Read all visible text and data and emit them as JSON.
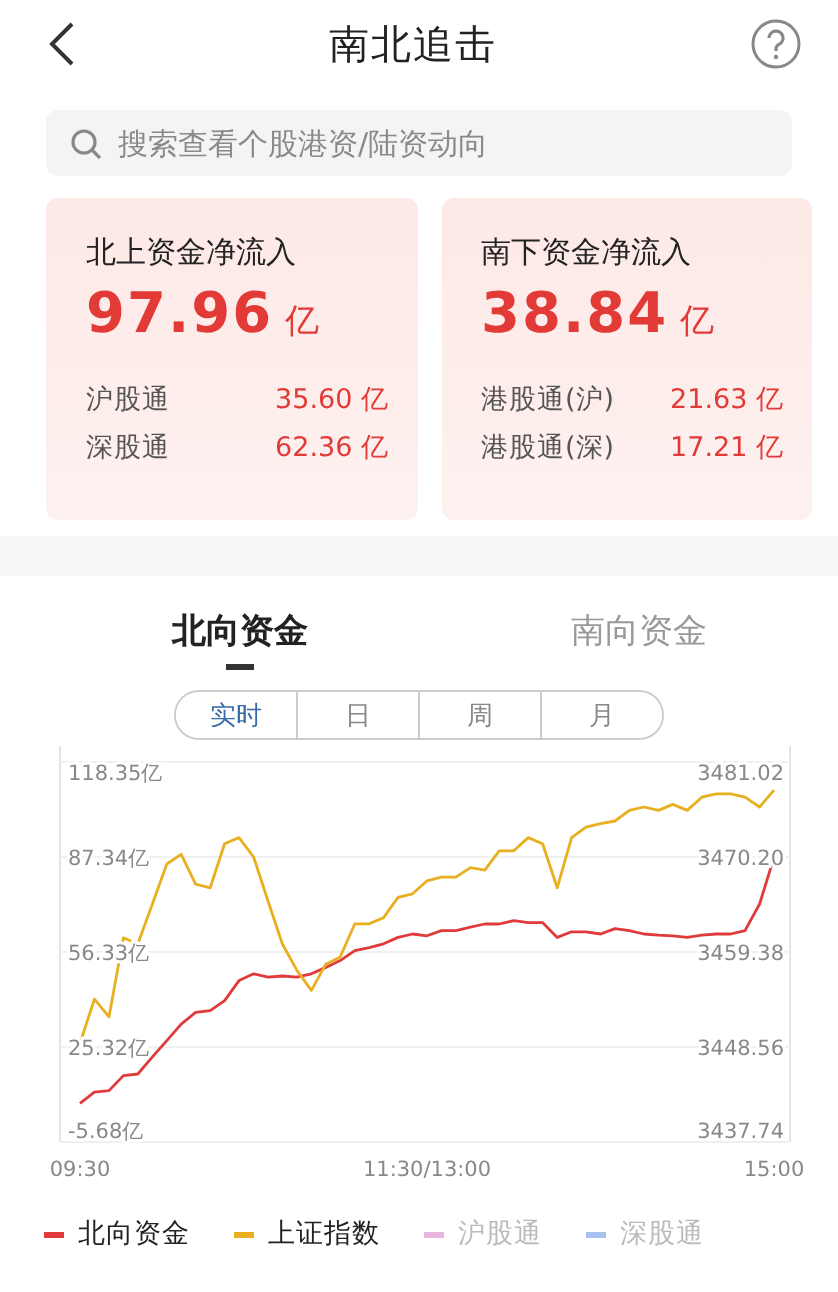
{
  "header": {
    "title": "南北追击"
  },
  "search": {
    "placeholder": "搜索查看个股港资/陆资动向"
  },
  "cards": [
    {
      "title": "北上资金净流入",
      "amount": "97.96",
      "unit": "亿",
      "rows": [
        {
          "label": "沪股通",
          "value": "35.60 亿"
        },
        {
          "label": "深股通",
          "value": "62.36 亿"
        }
      ]
    },
    {
      "title": "南下资金净流入",
      "amount": "38.84",
      "unit": "亿",
      "rows": [
        {
          "label": "港股通(沪)",
          "value": "21.63 亿"
        },
        {
          "label": "港股通(深)",
          "value": "17.21 亿"
        }
      ]
    }
  ],
  "tabs": [
    {
      "label": "北向资金",
      "selected": true
    },
    {
      "label": "南向资金",
      "selected": false
    }
  ],
  "periods": [
    {
      "label": "实时",
      "selected": true
    },
    {
      "label": "日",
      "selected": false
    },
    {
      "label": "周",
      "selected": false
    },
    {
      "label": "月",
      "selected": false
    }
  ],
  "chart_data": {
    "type": "line",
    "categories": [
      "09:30",
      null,
      null,
      null,
      null,
      null,
      null,
      null,
      null,
      null,
      null,
      null,
      null,
      null,
      null,
      null,
      null,
      null,
      null,
      null,
      null,
      null,
      null,
      null,
      "11:30/13:00",
      null,
      null,
      null,
      null,
      null,
      null,
      null,
      null,
      null,
      null,
      null,
      null,
      null,
      null,
      null,
      null,
      null,
      null,
      null,
      null,
      null,
      null,
      null,
      "15:00"
    ],
    "grid": true,
    "ylim": [
      -5.68,
      118.35
    ],
    "yticks": [
      {
        "value": 118.35,
        "label": "118.35亿"
      },
      {
        "value": 87.34,
        "label": "87.34亿"
      },
      {
        "value": 56.33,
        "label": "56.33亿"
      },
      {
        "value": 25.32,
        "label": "25.32亿"
      },
      {
        "value": -5.68,
        "label": "-5.68亿"
      }
    ],
    "y2lim": [
      3437.74,
      3481.02
    ],
    "y2ticks": [
      3481.02,
      {
        "value": 3470.2,
        "label": "3470.20"
      },
      3459.38,
      3448.56,
      3437.74
    ],
    "series": [
      {
        "name": "北向资金",
        "color": "#e03a3a",
        "values": [
          6.9,
          10.6,
          11.1,
          16.0,
          16.5,
          22.0,
          27.4,
          32.8,
          36.6,
          37.2,
          40.5,
          47.0,
          49.2,
          48.1,
          48.5,
          48.1,
          49.2,
          51.3,
          53.5,
          56.8,
          57.8,
          59.0,
          61.1,
          62.2,
          61.6,
          63.3,
          63.3,
          64.4,
          65.5,
          65.5,
          66.6,
          65.9,
          65.9,
          61.1,
          62.9,
          62.9,
          62.2,
          64.0,
          63.3,
          62.2,
          61.8,
          61.6,
          61.1,
          61.8,
          62.2,
          62.2,
          63.3,
          72.0,
          87.2
        ]
      },
      {
        "name": "上证指数",
        "color": "#e8b020",
        "axis": "y2",
        "values": [
          3449,
          3454,
          3452,
          3461,
          3460.3,
          3464.8,
          3469.4,
          3470.5,
          3467.1,
          3466.7,
          3471.7,
          3472.4,
          3470.2,
          3465.2,
          3460.3,
          3457.3,
          3455.0,
          3458.0,
          3458.8,
          3462.6,
          3462.6,
          3463.3,
          3465.6,
          3466.0,
          3467.5,
          3467.9,
          3467.9,
          3469.0,
          3468.7,
          3470.9,
          3470.9,
          3472.4,
          3471.7,
          3466.7,
          3472.4,
          3473.6,
          3474.0,
          3474.3,
          3475.5,
          3475.9,
          3475.5,
          3476.2,
          3475.5,
          3477.0,
          3477.4,
          3477.4,
          3477.0,
          3475.9,
          3477.8
        ]
      },
      {
        "name": "沪股通",
        "color": "#e8b4e0",
        "values": [
          null,
          null,
          null,
          null,
          null,
          null,
          null,
          null,
          null,
          null,
          null,
          null,
          null,
          null,
          null,
          null,
          null,
          null,
          null,
          null,
          null,
          null,
          null,
          null,
          null,
          null,
          null,
          null,
          null,
          null,
          null,
          null,
          null,
          null,
          null,
          null,
          null,
          null,
          null,
          null,
          null,
          null,
          null,
          null,
          null,
          null,
          null,
          null,
          null
        ]
      },
      {
        "name": "深股通",
        "color": "#a8c0f0",
        "values": [
          null,
          null,
          null,
          null,
          null,
          null,
          null,
          null,
          null,
          null,
          null,
          null,
          null,
          null,
          null,
          null,
          null,
          null,
          null,
          null,
          null,
          null,
          null,
          null,
          null,
          null,
          null,
          null,
          null,
          null,
          null,
          null,
          null,
          null,
          null,
          null,
          null,
          null,
          null,
          null,
          null,
          null,
          null,
          null,
          null,
          null,
          null,
          null,
          null
        ]
      }
    ]
  }
}
